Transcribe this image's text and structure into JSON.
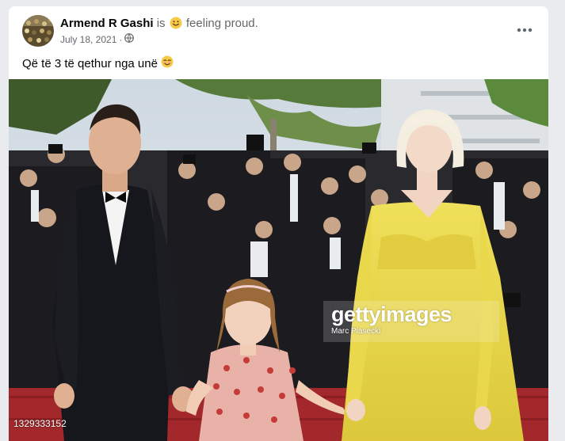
{
  "post": {
    "author": "Armend R Gashi",
    "activity_prefix": "is",
    "activity_emoji_icon": "smiling-face-icon",
    "activity": "feeling proud.",
    "date": "July 18, 2021",
    "separator": "·",
    "privacy_icon": "globe-icon",
    "more_icon": "more-options-icon",
    "caption_text": "Që të 3 të qethur nga unë",
    "caption_emoji_icon": "smiling-face-icon"
  },
  "photo": {
    "watermark_logo": "gettyimages",
    "watermark_credit": "Marc Piasecki",
    "image_id": "1329333152"
  },
  "colors": {
    "page_background": "#e9ebee",
    "card_background": "#ffffff",
    "secondary_text": "#65676b",
    "carpet_red": "#a3282b",
    "dress_yellow": "#e6d444"
  }
}
